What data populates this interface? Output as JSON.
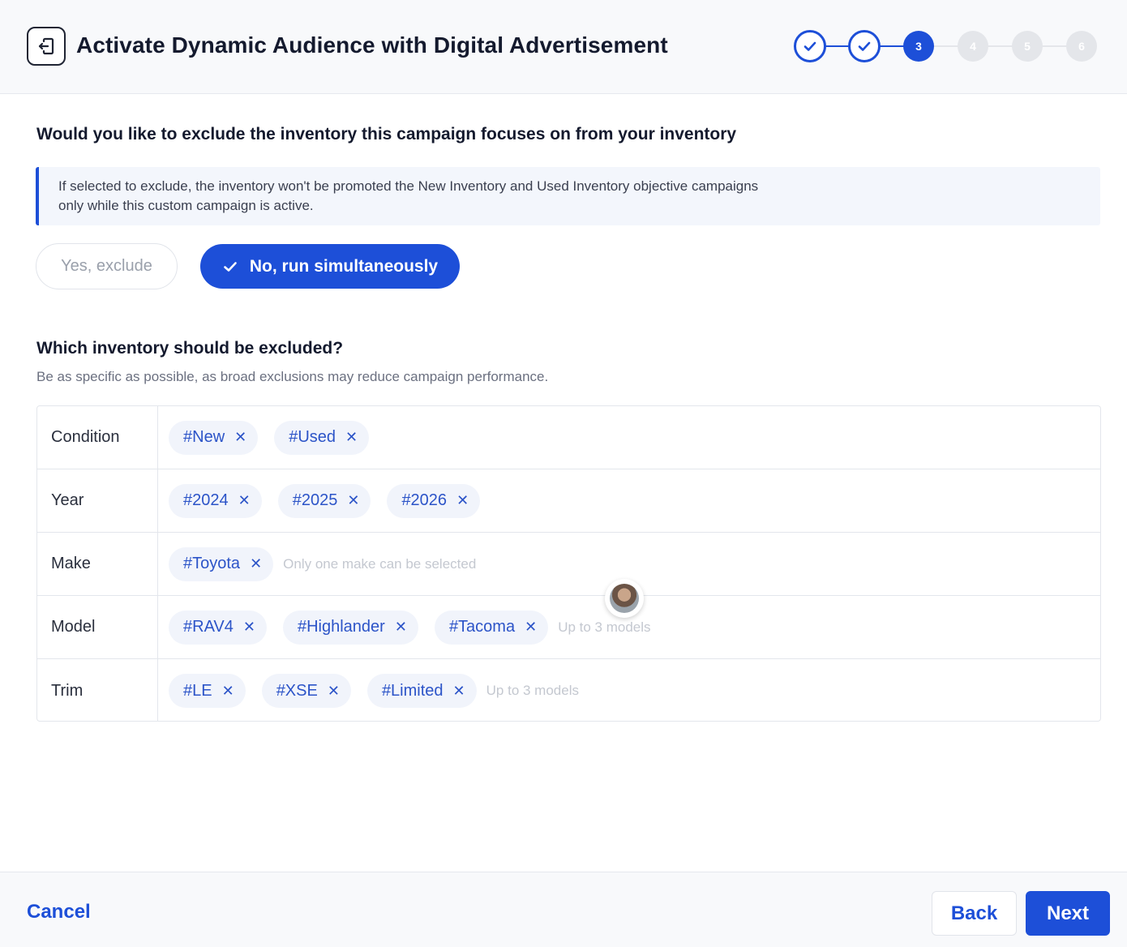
{
  "header": {
    "title": "Activate Dynamic Audience with Digital Advertisement",
    "steps": [
      {
        "label": "",
        "state": "done"
      },
      {
        "label": "",
        "state": "done"
      },
      {
        "label": "3",
        "state": "current"
      },
      {
        "label": "4",
        "state": "todo"
      },
      {
        "label": "5",
        "state": "todo"
      },
      {
        "label": "6",
        "state": "todo"
      }
    ],
    "current_step": 3
  },
  "exclude_section": {
    "question": "Would you like to exclude the inventory this campaign focuses on from your inventory",
    "info_line1": "If selected to exclude, the inventory won't be promoted the New Inventory and Used Inventory objective campaigns",
    "info_line2": "only while this custom campaign is active.",
    "option_yes": "Yes, exclude",
    "option_no": "No, run simultaneously",
    "selected": "No, run simultaneously"
  },
  "inventory_section": {
    "title": "Which inventory should be excluded?",
    "subtitle": "Be as specific as possible, as broad exclusions may reduce campaign performance.",
    "rows": [
      {
        "label": "Condition",
        "chips": [
          "#New",
          "#Used"
        ],
        "hint": ""
      },
      {
        "label": "Year",
        "chips": [
          "#2024",
          "#2025",
          "#2026"
        ],
        "hint": ""
      },
      {
        "label": "Make",
        "chips": [
          "#Toyota"
        ],
        "hint": "Only one make can be selected"
      },
      {
        "label": "Model",
        "chips": [
          "#RAV4",
          "#Highlander",
          "#Tacoma"
        ],
        "hint": "Up to 3 models"
      },
      {
        "label": "Trim",
        "chips": [
          "#LE",
          "#XSE",
          "#Limited"
        ],
        "hint": "Up to 3 models"
      }
    ]
  },
  "footer": {
    "cancel": "Cancel",
    "back": "Back",
    "next": "Next"
  },
  "colors": {
    "accent": "#1d4fd8",
    "chip_bg": "#f1f4fb",
    "chip_text": "#2c54c8"
  }
}
